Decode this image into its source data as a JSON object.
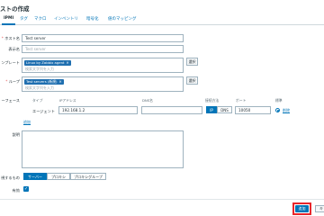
{
  "title": "ストの作成",
  "tabs": [
    "IPMI",
    "タグ",
    "マクロ",
    "インベントリ",
    "暗号化",
    "値のマッピング"
  ],
  "labels": {
    "host_name": "ホスト名",
    "visible_name": "表示名",
    "templates": "ンプレート",
    "groups": "ループ",
    "interfaces": "ーフェース",
    "description": "説明",
    "monitored_by": "視するもの",
    "enabled": "有効"
  },
  "fields": {
    "host_name": "Test server",
    "visible_name_placeholder": "Test server",
    "template_chip": "Linux by Zabbix agent",
    "template_search": "検索文字列を入力",
    "group_chip": "Test servers (新規)",
    "group_search": "検索文字列を入力",
    "select_label": "選択"
  },
  "interfaces": {
    "headers": [
      "タイプ",
      "IPアドレス",
      "DNS名",
      "接続方法",
      "ポート",
      "標準"
    ],
    "row_type": "エージェント",
    "ip": "192.168.1.2",
    "dns": "",
    "connect_ip": "IP",
    "connect_dns": "DNS",
    "port": "10050",
    "remove": "削除",
    "add": "追加"
  },
  "monitored_by": [
    "サーバー",
    "プロキシ",
    "プロキシグループ"
  ],
  "buttons": {
    "add": "追加",
    "cancel": "キ"
  },
  "colors": {
    "accent": "#0275b8",
    "highlight": "#e8262b"
  }
}
